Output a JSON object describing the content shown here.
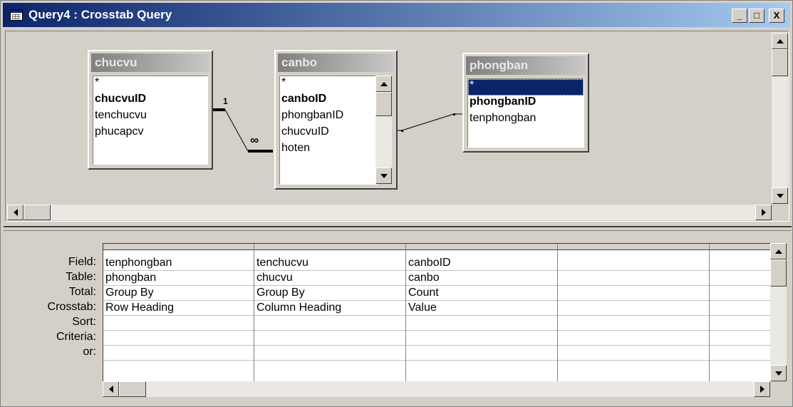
{
  "window": {
    "title": "Query4 : Crosstab Query",
    "buttons": {
      "minimize": "_",
      "maximize": "□",
      "close": "X"
    }
  },
  "tables": [
    {
      "name": "chucvu",
      "fields": [
        "*",
        "chucvuID",
        "tenchucvu",
        "phucapcv"
      ],
      "key_fields": [
        "chucvuID"
      ],
      "selected": null
    },
    {
      "name": "canbo",
      "fields": [
        "*",
        "canboID",
        "phongbanID",
        "chucvuID",
        "hoten"
      ],
      "key_fields": [
        "canboID"
      ],
      "selected": null
    },
    {
      "name": "phongban",
      "fields": [
        "*",
        "phongbanID",
        "tenphongban"
      ],
      "key_fields": [
        "phongbanID"
      ],
      "selected": "*"
    }
  ],
  "relationships": [
    {
      "from": "chucvu.chucvuID",
      "to": "canbo.chucvuID",
      "from_label": "1",
      "to_label": "∞"
    },
    {
      "from": "canbo.phongbanID",
      "to": "phongban.*"
    }
  ],
  "grid": {
    "row_labels": [
      "Field:",
      "Table:",
      "Total:",
      "Crosstab:",
      "Sort:",
      "Criteria:",
      "or:"
    ],
    "columns": [
      {
        "Field": "tenphongban",
        "Table": "phongban",
        "Total": "Group By",
        "Crosstab": "Row Heading",
        "Sort": "",
        "Criteria": "",
        "or": ""
      },
      {
        "Field": "tenchucvu",
        "Table": "chucvu",
        "Total": "Group By",
        "Crosstab": "Column Heading",
        "Sort": "",
        "Criteria": "",
        "or": ""
      },
      {
        "Field": "canboID",
        "Table": "canbo",
        "Total": "Count",
        "Crosstab": "Value",
        "Sort": "",
        "Criteria": "",
        "or": ""
      },
      {
        "Field": "",
        "Table": "",
        "Total": "",
        "Crosstab": "",
        "Sort": "",
        "Criteria": "",
        "or": ""
      },
      {
        "Field": "",
        "Table": "",
        "Total": "",
        "Crosstab": "",
        "Sort": "",
        "Criteria": "",
        "or": ""
      }
    ]
  },
  "colors": {
    "title_start": "#0a246a",
    "title_end": "#a6caf0",
    "face": "#d4d0c8",
    "selection": "#0a246a"
  }
}
